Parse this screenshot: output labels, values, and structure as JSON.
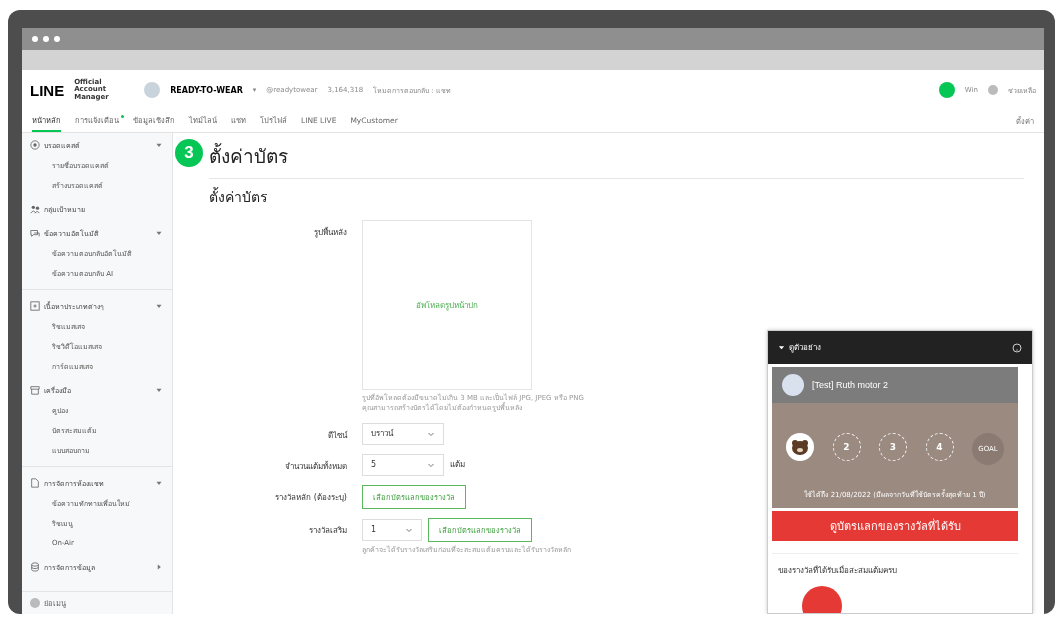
{
  "header": {
    "logo": "LINE",
    "logo_sub": "Official Account Manager",
    "account": "READY-TO-WEAR",
    "account_caret": "▾",
    "handle": "@readytowear",
    "friends": "3,164,318",
    "reply_mode": "โหมดการตอบกลับ : แชท",
    "user": "Win",
    "help": "ช่วยเหลือ",
    "settings": "ตั้งค่า"
  },
  "nav": [
    {
      "label": "หน้าหลัก",
      "selected": true,
      "dot": false
    },
    {
      "label": "การแจ้งเตือน",
      "selected": false,
      "dot": true
    },
    {
      "label": "ข้อมูลเชิงลึก",
      "selected": false,
      "dot": false
    },
    {
      "label": "ไทม์ไลน์",
      "selected": false,
      "dot": false
    },
    {
      "label": "แชท",
      "selected": false,
      "dot": false
    },
    {
      "label": "โปรไฟล์",
      "selected": false,
      "dot": false
    },
    {
      "label": "LINE LIVE",
      "selected": false,
      "dot": false
    },
    {
      "label": "MyCustomer",
      "selected": false,
      "dot": false
    }
  ],
  "sidebar": [
    {
      "label": "บรอดแคสต์",
      "expanded": true,
      "divider": false,
      "children": [
        {
          "label": "รายชื่อบรอดแคสต์"
        },
        {
          "label": "สร้างบรอดแคสต์"
        }
      ]
    },
    {
      "label": "กลุ่มเป้าหมาย",
      "divider": false
    },
    {
      "label": "ข้อความอัตโนมัติ",
      "expanded": true,
      "divider": false,
      "children": [
        {
          "label": "ข้อความตอบกลับอัตโนมัติ"
        },
        {
          "label": "ข้อความตอบกลับ AI"
        }
      ]
    },
    {
      "label": "เนื้อหาประเภทต่างๆ",
      "expanded": true,
      "divider": true,
      "children": [
        {
          "label": "ริชแมสเสจ"
        },
        {
          "label": "ริชวิดีโอแมสเสจ"
        },
        {
          "label": "การ์ดแมสเสจ"
        }
      ]
    },
    {
      "label": "เครื่องมือ",
      "expanded": true,
      "divider": false,
      "children": [
        {
          "label": "คูปอง"
        },
        {
          "label": "บัตรสะสมแต้ม"
        },
        {
          "label": "แบบสอบถาม"
        }
      ]
    },
    {
      "label": "การจัดการห้องแชท",
      "expanded": true,
      "divider": true,
      "children": [
        {
          "label": "ข้อความทักทายเพื่อนใหม่"
        },
        {
          "label": "ริชเมนู"
        },
        {
          "label": "On-Air"
        }
      ]
    },
    {
      "label": "การจัดการข้อมูล",
      "expanded": false,
      "divider": false
    }
  ],
  "sidebar_footer": "ย่อเมนู",
  "step_badge": "3",
  "page_title": "ตั้งค่าบัตร",
  "section_title": "ตั้งค่าบัตร",
  "form": {
    "background_label": "รูปพื้นหลัง",
    "upload": "อัพโหลดรูปหน้าปก",
    "upload_hint": [
      "รูปที่อัพโหลดต้องมีขนาดไม่เกิน 3 MB และเป็นไฟล์ JPG, JPEG หรือ PNG",
      "คุณสามารถสร้างบัตรได้โดยไม่ต้องกำหนดรูปพื้นหลัง"
    ],
    "design_label": "ดีไซน์",
    "design_value": "บราวน์",
    "points_label": "จำนวนแต้มทั้งหมด",
    "points_value": "5",
    "points_unit": "แต้ม",
    "main_reward_label": "รางวัลหลัก (ต้องระบุ)",
    "main_reward_button": "เลือกบัตรแลกของรางวัล",
    "extra_reward_label": "รางวัลเสริม",
    "extra_reward_value": "1",
    "extra_reward_button": "เลือกบัตรแลกของรางวัล",
    "extra_reward_hint": "ลูกค้าจะได้รับรางวัลเสริมก่อนที่จะสะสมแต้มครบและได้รับรางวัลหลัก"
  },
  "preview": {
    "title": "ดูตัวอย่าง",
    "card_name": "[Test] Ruth motor 2",
    "stamps": [
      {
        "kind": "stamped"
      },
      {
        "kind": "empty",
        "label": "2"
      },
      {
        "kind": "empty",
        "label": "3"
      },
      {
        "kind": "empty",
        "label": "4"
      },
      {
        "kind": "goal",
        "label": "GOAL"
      }
    ],
    "valid": "ใช้ได้ถึง 21/08/2022 (มีผลจากวันที่ใช้บัตรครั้งสุดท้าย 1 ปี)",
    "rewards_button": "ดูบัตรแลกของรางวัลที่ได้รับ",
    "rewards_title": "ของรางวัลที่ได้รับเมื่อสะสมแต้มครบ"
  }
}
